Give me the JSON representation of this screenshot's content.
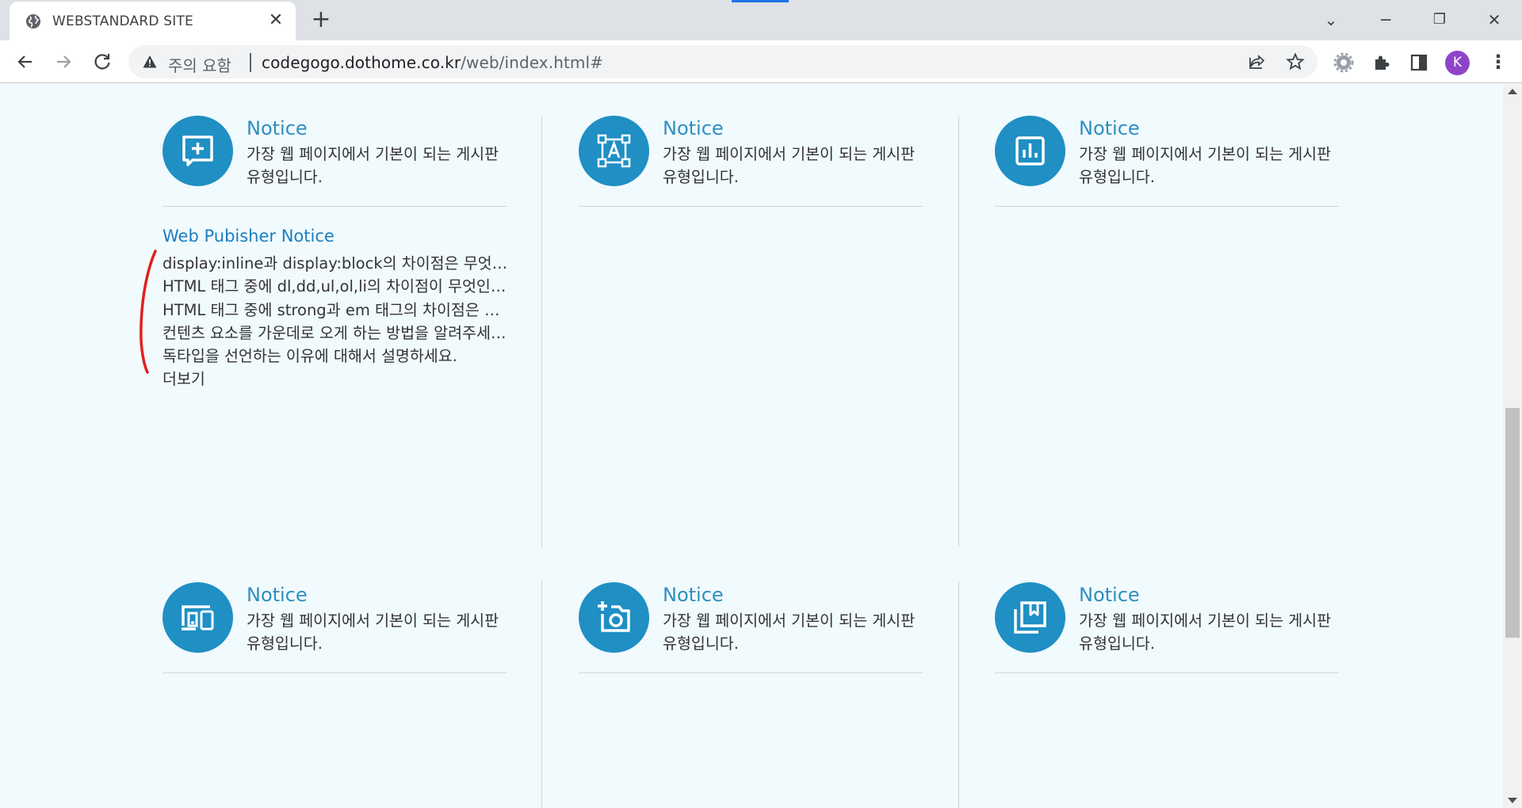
{
  "browser": {
    "tab_title": "WEBSTANDARD SITE",
    "security_label": "주의 요함",
    "url_host": "codegogo.dothome.co.kr",
    "url_path": "/web/index.html#",
    "profile_initial": "K"
  },
  "cards": [
    {
      "title": "Notice",
      "desc": "가장 웹 페이지에서 기본이 되는 게시판 유형입니다.",
      "icon": "add-comment-icon"
    },
    {
      "title": "Notice",
      "desc": "가장 웹 페이지에서 기본이 되는 게시판 유형입니다.",
      "icon": "text-frame-icon"
    },
    {
      "title": "Notice",
      "desc": "가장 웹 페이지에서 기본이 되는 게시판 유형입니다.",
      "icon": "bar-chart-icon"
    },
    {
      "title": "Notice",
      "desc": "가장 웹 페이지에서 기본이 되는 게시판 유형입니다.",
      "icon": "devices-icon"
    },
    {
      "title": "Notice",
      "desc": "가장 웹 페이지에서 기본이 되는 게시판 유형입니다.",
      "icon": "add-camera-icon"
    },
    {
      "title": "Notice",
      "desc": "가장 웹 페이지에서 기본이 되는 게시판 유형입니다.",
      "icon": "bookmark-library-icon"
    }
  ],
  "notice": {
    "heading": "Web Pubisher Notice",
    "items": [
      "display:inline과 display:block의 차이점은 무엇인가요?",
      "HTML 태그 중에 dl,dd,ul,ol,li의 차이점이 무엇인가요?",
      "HTML 태그 중에 strong과 em 태그의 차이점은 무엇인가요?",
      "컨텐츠 요소를 가운데로 오게 하는 방법을 알려주세요.",
      "독타입을 선언하는 이유에 대해서 설명하세요."
    ],
    "more": "더보기"
  },
  "colors": {
    "accent": "#1f8fc4",
    "title": "#2f8fbf",
    "page_bg": "#f1fafd",
    "annotation": "#e02020"
  }
}
